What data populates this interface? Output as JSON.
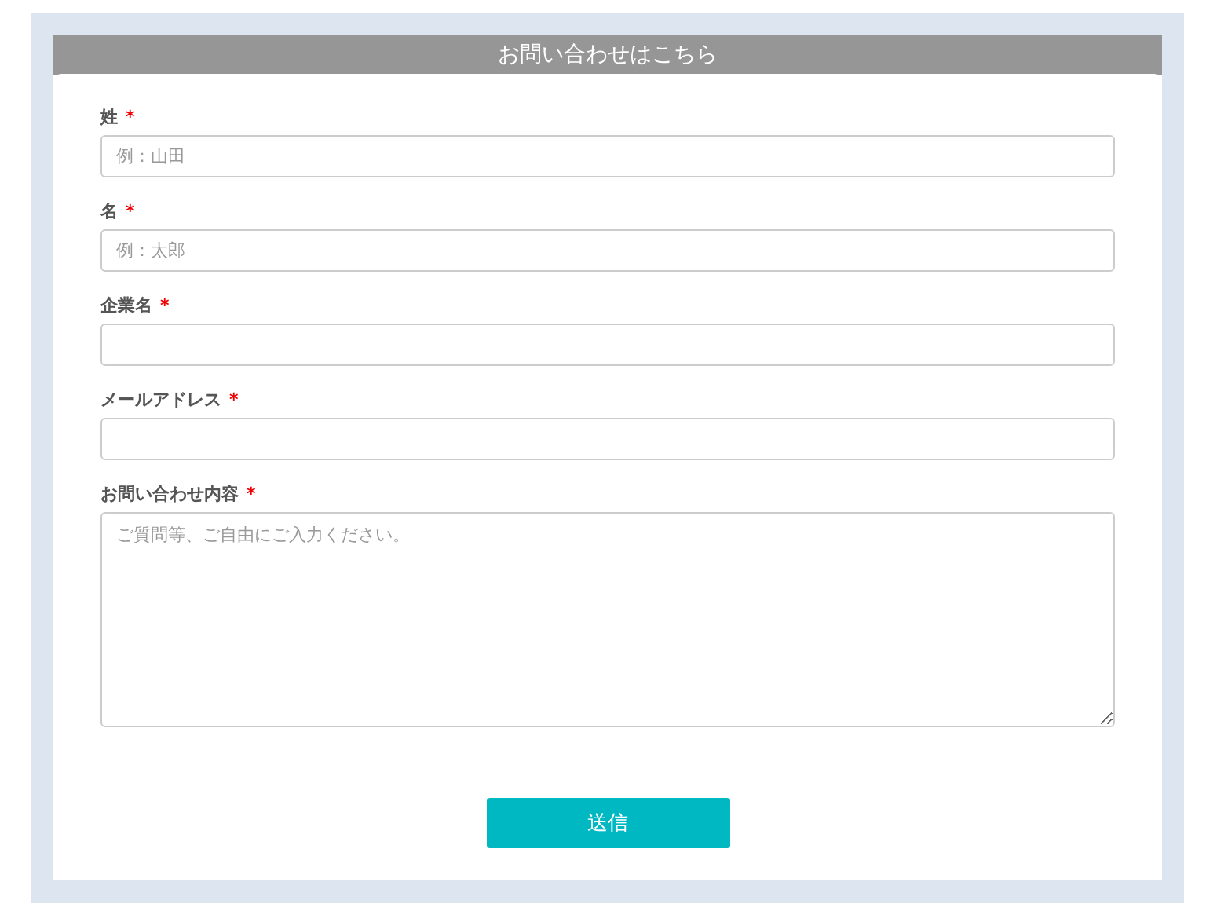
{
  "header": {
    "title": "お問い合わせはこちら"
  },
  "fields": [
    {
      "kind": "input",
      "label": "姓",
      "mark": "*",
      "placeholder": "例：山田"
    },
    {
      "kind": "input",
      "label": "名",
      "mark": "*",
      "placeholder": "例：太郎"
    },
    {
      "kind": "input",
      "label": "企業名",
      "mark": "*"
    },
    {
      "kind": "input",
      "label": "メールアドレス",
      "mark": "*"
    },
    {
      "kind": "textarea",
      "label": "お問い合わせ内容",
      "mark": "*",
      "placeholder": "ご質問等、ご自由にご入力ください。"
    }
  ],
  "submit": {
    "label": "送信"
  }
}
